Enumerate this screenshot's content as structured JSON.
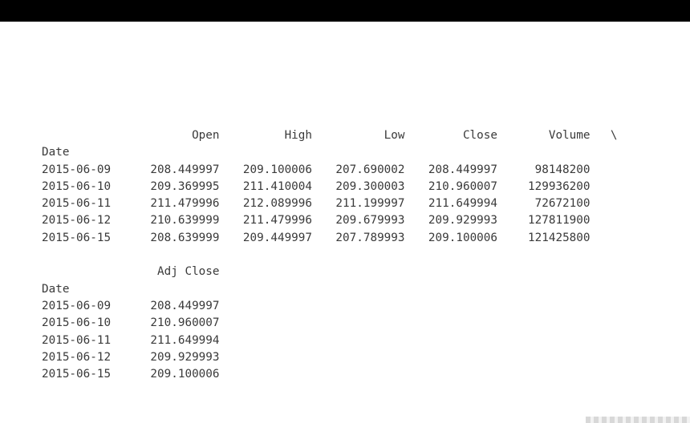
{
  "watermark": "",
  "table1": {
    "columns": [
      "Open",
      "High",
      "Low",
      "Close",
      "Volume"
    ],
    "continuation": "\\",
    "index_name": "Date",
    "rows": [
      {
        "date": "2015-06-09",
        "values": [
          "208.449997",
          "209.100006",
          "207.690002",
          "208.449997",
          "98148200"
        ]
      },
      {
        "date": "2015-06-10",
        "values": [
          "209.369995",
          "211.410004",
          "209.300003",
          "210.960007",
          "129936200"
        ]
      },
      {
        "date": "2015-06-11",
        "values": [
          "211.479996",
          "212.089996",
          "211.199997",
          "211.649994",
          "72672100"
        ]
      },
      {
        "date": "2015-06-12",
        "values": [
          "210.639999",
          "211.479996",
          "209.679993",
          "209.929993",
          "127811900"
        ]
      },
      {
        "date": "2015-06-15",
        "values": [
          "208.639999",
          "209.449997",
          "207.789993",
          "209.100006",
          "121425800"
        ]
      }
    ]
  },
  "table2": {
    "columns": [
      "Adj Close"
    ],
    "index_name": "Date",
    "rows": [
      {
        "date": "2015-06-09",
        "values": [
          "208.449997"
        ]
      },
      {
        "date": "2015-06-10",
        "values": [
          "210.960007"
        ]
      },
      {
        "date": "2015-06-11",
        "values": [
          "211.649994"
        ]
      },
      {
        "date": "2015-06-12",
        "values": [
          "209.929993"
        ]
      },
      {
        "date": "2015-06-15",
        "values": [
          "209.100006"
        ]
      }
    ]
  }
}
